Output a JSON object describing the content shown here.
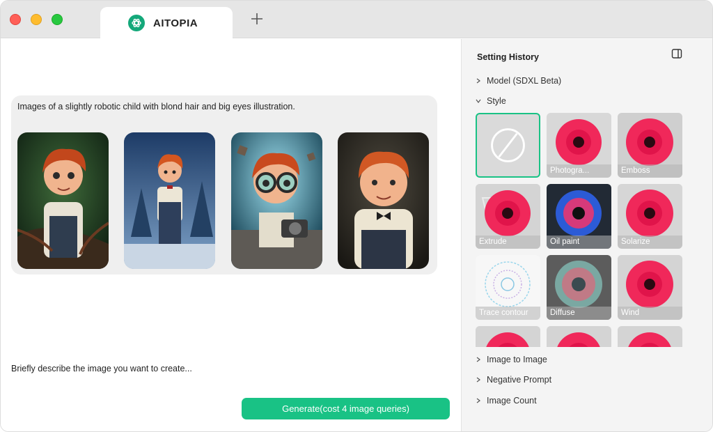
{
  "window": {
    "tab_title": "AITOPIA"
  },
  "main": {
    "prompt": "Images of a slightly robotic child with blond hair and big eyes illustration.",
    "describe_placeholder": "Briefly describe the image you want to create...",
    "generate_label": "Generate(cost 4 image queries)"
  },
  "sidebar": {
    "title": "Setting History",
    "sections": {
      "model": "Model (SDXL Beta)",
      "style": "Style",
      "image_to_image": "Image to Image",
      "negative_prompt": "Negative Prompt",
      "image_count": "Image Count"
    },
    "styles": [
      {
        "label": "",
        "selected": true
      },
      {
        "label": "Photogra..."
      },
      {
        "label": "Emboss"
      },
      {
        "label": "Extrude"
      },
      {
        "label": "Oil paint"
      },
      {
        "label": "Solarize"
      },
      {
        "label": "Trace contour"
      },
      {
        "label": "Diffuse"
      },
      {
        "label": "Wind"
      },
      {
        "label": ""
      },
      {
        "label": ""
      },
      {
        "label": ""
      }
    ]
  },
  "colors": {
    "accent": "#19c285",
    "flower": "#f0285a"
  }
}
